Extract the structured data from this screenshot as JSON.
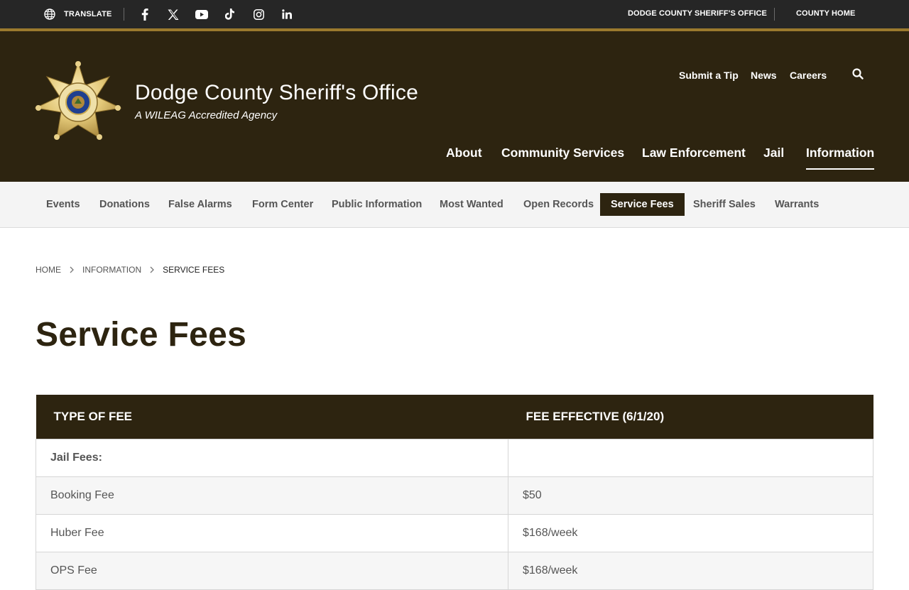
{
  "topbar": {
    "translate_label": "TRANSLATE",
    "social_icons": [
      "facebook-icon",
      "x-icon",
      "youtube-icon",
      "tiktok-icon",
      "instagram-icon",
      "linkedin-icon"
    ],
    "links": [
      "DODGE COUNTY SHERIFF'S OFFICE",
      "COUNTY HOME"
    ]
  },
  "header": {
    "title": "Dodge County Sheriff's Office",
    "subtitle": "A WILEAG Accredited Agency",
    "utility_nav": [
      "Submit a Tip",
      "News",
      "Careers"
    ],
    "main_nav": [
      "About",
      "Community Services",
      "Law Enforcement",
      "Jail",
      "Information"
    ],
    "active_main": "Information"
  },
  "subnav": {
    "items": [
      "Events",
      "Donations",
      "False Alarms",
      "Form Center",
      "Public Information",
      "Most Wanted",
      "Open Records",
      "Service Fees",
      "Sheriff Sales",
      "Warrants"
    ],
    "active": "Service Fees"
  },
  "breadcrumb": [
    "HOME",
    "INFORMATION",
    "SERVICE FEES"
  ],
  "page": {
    "title": "Service Fees"
  },
  "fee_table": {
    "headers": [
      "TYPE OF FEE",
      "FEE EFFECTIVE (6/1/20)"
    ],
    "rows": [
      [
        "Jail Fees:",
        ""
      ],
      [
        "Booking Fee",
        "$50"
      ],
      [
        "Huber Fee",
        "$168/week"
      ],
      [
        "OPS Fee",
        "$168/week"
      ]
    ]
  },
  "colors": {
    "brand_dark": "#2d2410",
    "accent_gold": "#9b7a2e",
    "topbar": "#262626"
  }
}
